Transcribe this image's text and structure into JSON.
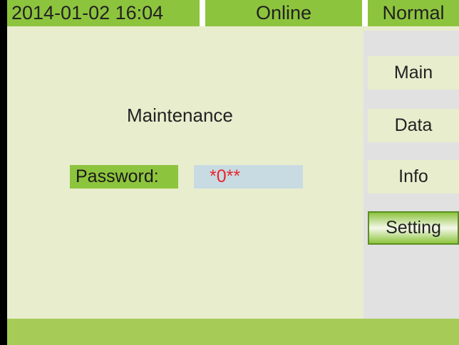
{
  "status_bar": {
    "datetime": "2014-01-02 16:04",
    "connection": "Online",
    "mode": "Normal"
  },
  "main": {
    "title": "Maintenance",
    "password_label": "Password:",
    "password_value": "*0**"
  },
  "menu": {
    "items": [
      {
        "label": "Main",
        "active": false
      },
      {
        "label": "Data",
        "active": false
      },
      {
        "label": "Info",
        "active": false
      },
      {
        "label": "Setting",
        "active": true
      }
    ]
  },
  "colors": {
    "accent_green": "#8dc43d",
    "panel_background": "#e8edcd",
    "input_background": "#c8dbe3",
    "password_text": "#e8262e",
    "menu_background": "#e1e1e1",
    "bottom_bar": "#a6cc57"
  }
}
